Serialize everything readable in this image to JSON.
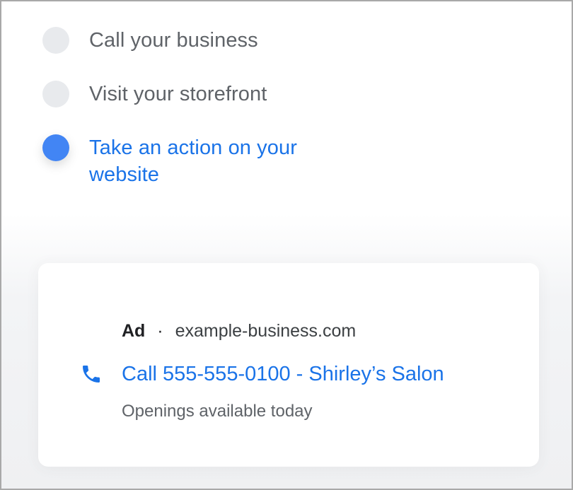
{
  "options": [
    {
      "label": "Call your business",
      "selected": false
    },
    {
      "label": "Visit your storefront",
      "selected": false
    },
    {
      "label": "Take an action on your website",
      "selected": true
    }
  ],
  "ad_preview": {
    "badge": "Ad",
    "separator": "·",
    "domain": "example-business.com",
    "headline": "Call 555-555-0100 - Shirley’s Salon",
    "description": "Openings available today",
    "icon": "phone-icon"
  },
  "colors": {
    "accent": "#1a73e8",
    "radio_selected": "#4285f4",
    "radio_unselected": "#e8eaed",
    "text_muted": "#5f6368"
  }
}
